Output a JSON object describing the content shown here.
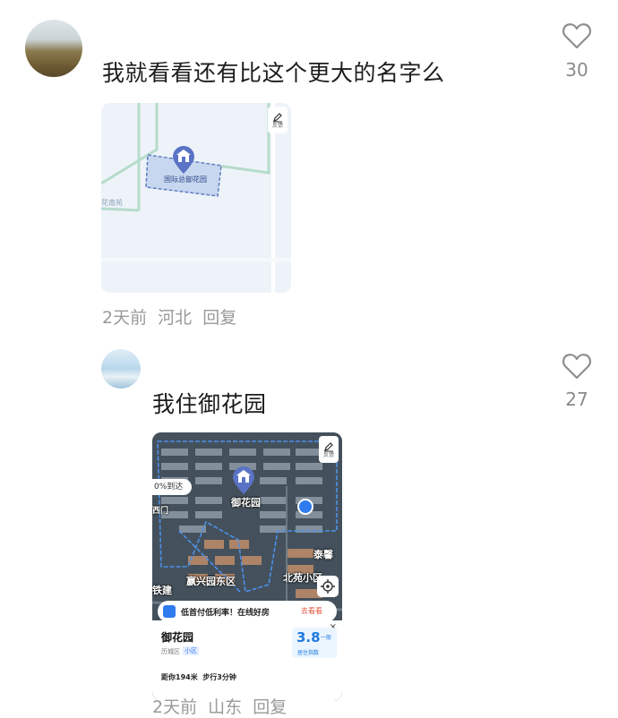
{
  "comments": [
    {
      "text": "我就看看还有比这个更大的名字么",
      "likes": "30",
      "time": "2天前",
      "location": "河北",
      "reply_label": "回复",
      "map": {
        "poi_name": "国际总御花园",
        "side_label": "花南苑",
        "edit_label": "反馈"
      }
    },
    {
      "text": "我住御花园",
      "likes": "27",
      "time": "2天前",
      "location": "山东",
      "reply_label": "回复",
      "map": {
        "poi_name": "御花园",
        "edit_label": "反馈",
        "arrival_badge": "0%到达",
        "area_label_1": "嬴兴园东区",
        "area_label_2": "北苑小区",
        "area_label_3": "泰馨",
        "area_label_4": "铁建",
        "area_label_5": "西门",
        "promo_text": "低首付低利率！在线好房",
        "promo_button": "去看看",
        "card_title": "御花园",
        "card_district": "历城区",
        "card_tag": "小区",
        "rating": "3.8",
        "rating_level": "一般",
        "rating_label": "居住指数",
        "distance_text": "距你194米  步行3分钟"
      }
    }
  ]
}
